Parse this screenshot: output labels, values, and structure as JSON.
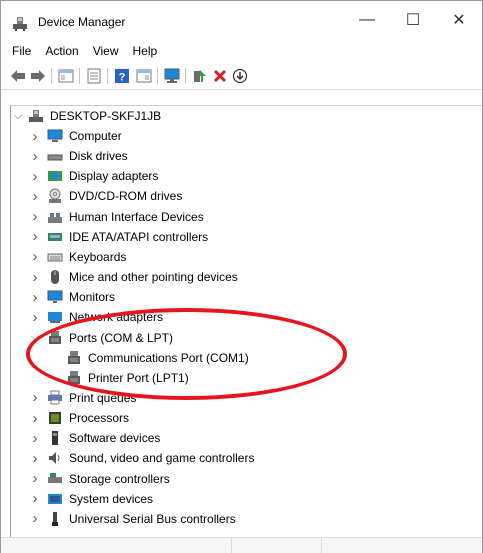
{
  "window": {
    "title": "Device Manager",
    "minimize": "—",
    "maximize": "☐",
    "close": "✕"
  },
  "menu": [
    "File",
    "Action",
    "View",
    "Help"
  ],
  "tree": {
    "root": "DESKTOP-SKFJ1JB",
    "items": [
      {
        "label": "Computer",
        "icon": "computer-icon"
      },
      {
        "label": "Disk drives",
        "icon": "disk-drive-icon"
      },
      {
        "label": "Display adapters",
        "icon": "display-adapter-icon"
      },
      {
        "label": "DVD/CD-ROM drives",
        "icon": "dvd-drive-icon"
      },
      {
        "label": "Human Interface Devices",
        "icon": "hid-icon"
      },
      {
        "label": "IDE ATA/ATAPI controllers",
        "icon": "ide-controller-icon"
      },
      {
        "label": "Keyboards",
        "icon": "keyboard-icon"
      },
      {
        "label": "Mice and other pointing devices",
        "icon": "mouse-icon"
      },
      {
        "label": "Monitors",
        "icon": "monitor-icon"
      },
      {
        "label": "Network adapters",
        "icon": "network-adapter-icon"
      },
      {
        "label": "Ports (COM & LPT)",
        "icon": "port-icon",
        "expanded": true,
        "children": [
          {
            "label": "Communications Port (COM1)",
            "icon": "port-icon"
          },
          {
            "label": "Printer Port (LPT1)",
            "icon": "port-icon"
          }
        ]
      },
      {
        "label": "Print queues",
        "icon": "printer-icon"
      },
      {
        "label": "Processors",
        "icon": "processor-icon"
      },
      {
        "label": "Software devices",
        "icon": "software-device-icon"
      },
      {
        "label": "Sound, video and game controllers",
        "icon": "sound-icon"
      },
      {
        "label": "Storage controllers",
        "icon": "storage-controller-icon"
      },
      {
        "label": "System devices",
        "icon": "system-devices-icon"
      },
      {
        "label": "Universal Serial Bus controllers",
        "icon": "usb-icon"
      }
    ]
  },
  "colors": {
    "annotation": "#e8141c",
    "monitor_blue": "#1e88d8",
    "uninstall_red": "#d81e1e",
    "enable_green": "#2ea043"
  }
}
